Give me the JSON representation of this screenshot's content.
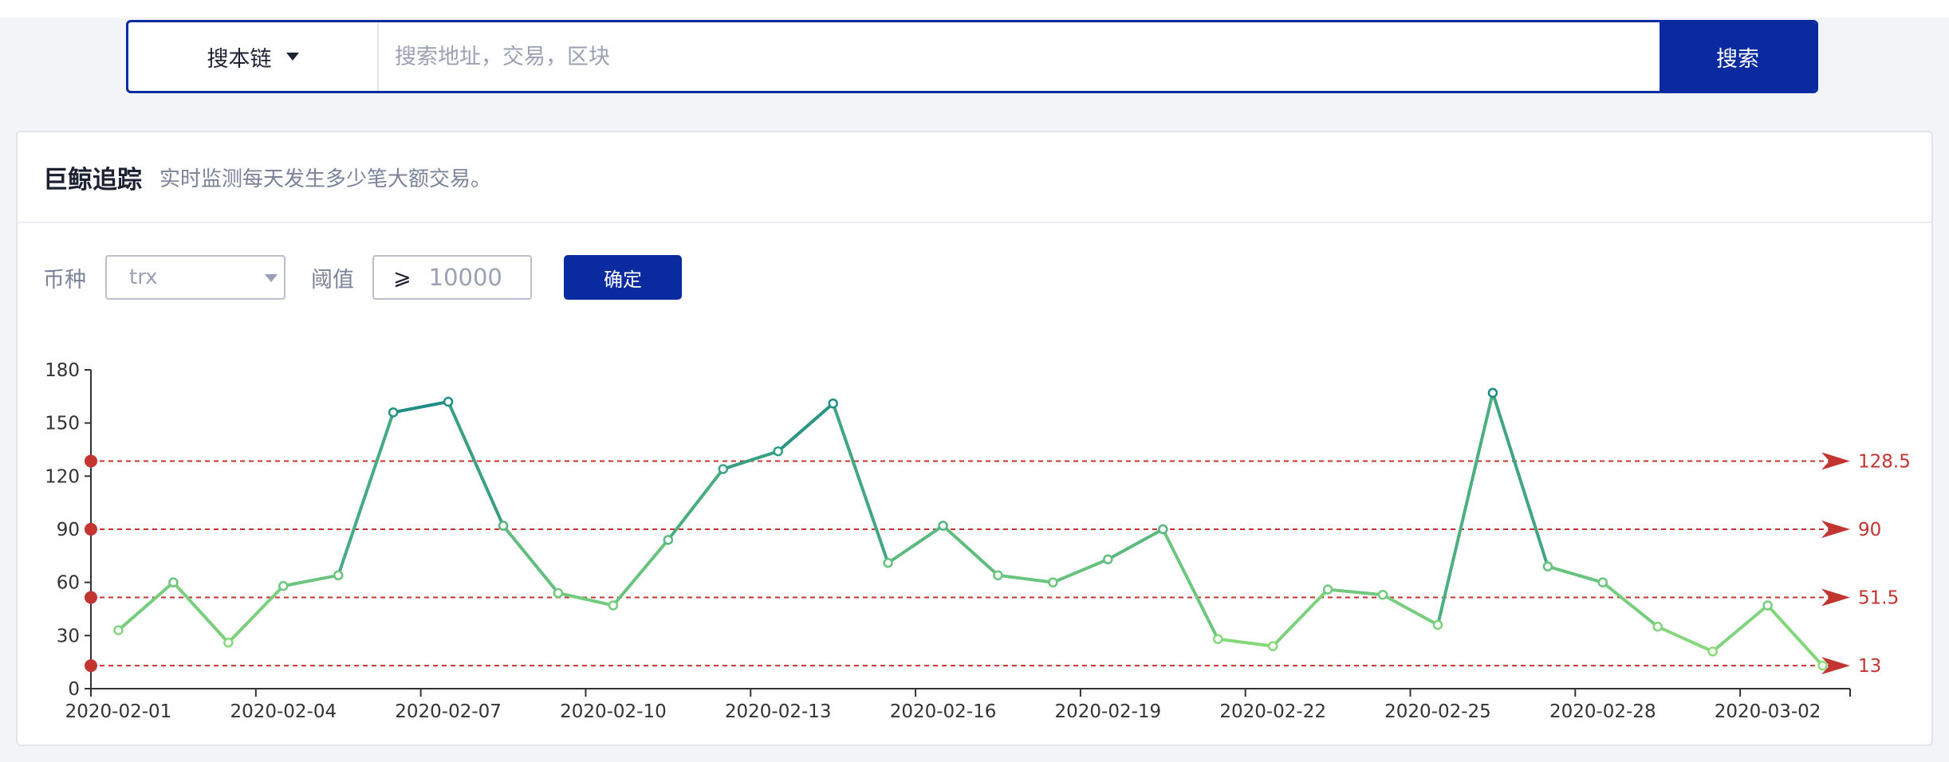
{
  "search": {
    "chain_label": "搜本链",
    "placeholder": "搜索地址，交易，区块",
    "button_label": "搜索"
  },
  "card": {
    "title": "巨鲸追踪",
    "subtitle": "实时监测每天发生多少笔大额交易。"
  },
  "filters": {
    "coin_label": "币种",
    "coin_value": "trx",
    "threshold_label": "阈值",
    "threshold_symbol": "⩾",
    "threshold_value": "10000",
    "confirm_label": "确定"
  },
  "colors": {
    "line_low": "#90e07a",
    "line_high": "#1a8a86",
    "markline": "#c23531",
    "axis": "#333333"
  },
  "chart_data": {
    "type": "line",
    "x": [
      "2020-02-01",
      "2020-02-02",
      "2020-02-03",
      "2020-02-04",
      "2020-02-05",
      "2020-02-06",
      "2020-02-07",
      "2020-02-08",
      "2020-02-09",
      "2020-02-10",
      "2020-02-11",
      "2020-02-12",
      "2020-02-13",
      "2020-02-14",
      "2020-02-15",
      "2020-02-16",
      "2020-02-17",
      "2020-02-18",
      "2020-02-19",
      "2020-02-20",
      "2020-02-21",
      "2020-02-22",
      "2020-02-23",
      "2020-02-24",
      "2020-02-25",
      "2020-02-26",
      "2020-02-27",
      "2020-02-28",
      "2020-02-29",
      "2020-03-01",
      "2020-03-02",
      "2020-03-03"
    ],
    "x_tick_labels": [
      "2020-02-01",
      "2020-02-04",
      "2020-02-07",
      "2020-02-10",
      "2020-02-13",
      "2020-02-16",
      "2020-02-19",
      "2020-02-22",
      "2020-02-25",
      "2020-02-28",
      "2020-03-02"
    ],
    "series": [
      {
        "values": [
          33,
          60,
          26,
          58,
          64,
          156,
          162,
          92,
          54,
          47,
          84,
          124,
          134,
          161,
          71,
          92,
          64,
          60,
          73,
          90,
          28,
          24,
          56,
          53,
          36,
          167,
          69,
          60,
          35,
          21,
          47,
          13
        ]
      }
    ],
    "ylim": [
      0,
      180
    ],
    "y_ticks": [
      "0",
      "30",
      "60",
      "90",
      "120",
      "150",
      "180"
    ],
    "mark_lines": [
      {
        "value": 128.5,
        "label": "128.5"
      },
      {
        "value": 90,
        "label": "90"
      },
      {
        "value": 51.5,
        "label": "51.5"
      },
      {
        "value": 13,
        "label": "13"
      }
    ],
    "color_range": [
      13,
      167
    ],
    "grid": false,
    "legend": "none"
  }
}
